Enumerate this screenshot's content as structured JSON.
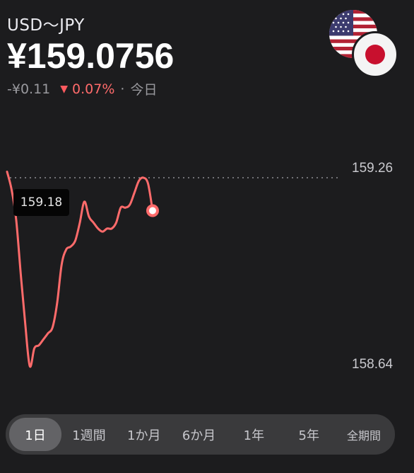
{
  "header": {
    "pair": "USD〜JPY",
    "price": "¥159.0756",
    "change_abs": "-¥0.11",
    "change_pct": "0.07%",
    "period": "今日",
    "down_icon": "▼"
  },
  "flags": {
    "base": "us-flag-icon",
    "quote": "jp-flag-icon"
  },
  "colors": {
    "background": "#1c1c1e",
    "line": "#ff6b6b",
    "negative": "#ff5a5f"
  },
  "chart_data": {
    "type": "line",
    "y_ticks": [
      "159.26",
      "158.64"
    ],
    "ylim": [
      158.64,
      159.26
    ],
    "reference_line": 159.26,
    "tooltip": "159.18",
    "grid": false,
    "series": [
      {
        "values": [
          159.28,
          159.22,
          159.12,
          158.94,
          158.77,
          158.63,
          158.69,
          158.7,
          158.72,
          158.74,
          158.76,
          158.84,
          158.97,
          159.02,
          159.03,
          159.05,
          159.11,
          159.18,
          159.13,
          159.11,
          159.09,
          159.08,
          159.09,
          159.09,
          159.11,
          159.16,
          159.16,
          159.17,
          159.21,
          159.25,
          159.26,
          159.24,
          159.15
        ]
      }
    ]
  },
  "ranges": {
    "tabs": [
      "1日",
      "1週間",
      "1か月",
      "6か月",
      "1年",
      "5年",
      "全期間"
    ],
    "selected": "1日"
  }
}
